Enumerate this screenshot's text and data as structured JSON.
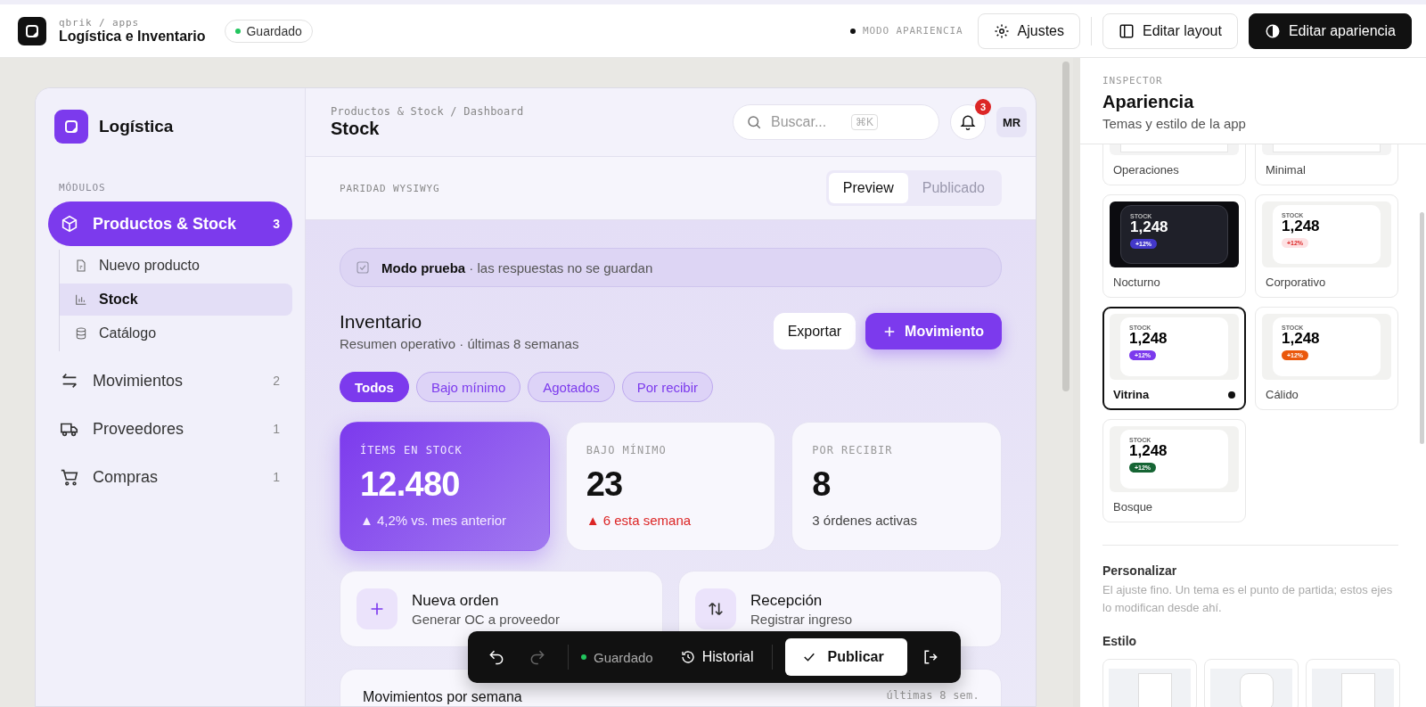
{
  "topbar": {
    "path": "qbrik / apps",
    "title": "Logística e Inventario",
    "status": "Guardado",
    "mode_label": "MODO APARIENCIA",
    "buttons": [
      {
        "label": "Ajustes",
        "kind": "settings",
        "selected": false
      },
      {
        "label": "Editar layout",
        "kind": "layout",
        "selected": false
      },
      {
        "label": "Editar apariencia",
        "kind": "appearance",
        "selected": true
      }
    ]
  },
  "sidebar": {
    "app_name": "Logística",
    "section": "MÓDULOS",
    "items": [
      {
        "label": "Productos & Stock",
        "count": "3",
        "selected": true,
        "expanded": true,
        "children": [
          {
            "label": "Nuevo producto",
            "selected": false
          },
          {
            "label": "Stock",
            "selected": true
          },
          {
            "label": "Catálogo",
            "selected": false
          }
        ]
      },
      {
        "label": "Movimientos",
        "count": "2",
        "selected": false
      },
      {
        "label": "Proveedores",
        "count": "1",
        "selected": false
      },
      {
        "label": "Compras",
        "count": "1",
        "selected": false
      }
    ]
  },
  "header": {
    "breadcrumb": "Productos & Stock / Dashboard",
    "title": "Stock",
    "search": {
      "placeholder": "Buscar...",
      "shortcut": "⌘K"
    },
    "notifications": "3",
    "avatar": "MR"
  },
  "parity": {
    "label": "PARIDAD WYSIWYG",
    "tabs": [
      {
        "label": "Preview",
        "selected": true
      },
      {
        "label": "Publicado",
        "selected": false
      }
    ]
  },
  "banner": "**Modo prueba** · las respuestas no se guardan",
  "section": {
    "title": "Inventario",
    "subtitle": "Resumen operativo · últimas 8 semanas",
    "buttons": [
      {
        "label": "Exportar",
        "kind": "secondary"
      },
      {
        "label": "Movimiento",
        "kind": "primary"
      }
    ]
  },
  "filters": [
    {
      "label": "Todos",
      "selected": true
    },
    {
      "label": "Bajo mínimo",
      "selected": false
    },
    {
      "label": "Agotados",
      "selected": false
    },
    {
      "label": "Por recibir",
      "selected": false
    }
  ],
  "stats": [
    {
      "label": "ÍTEMS EN STOCK",
      "value": "12.480",
      "delta": "▲ 4,2% vs. mes anterior",
      "kind": "highlight",
      "alert": false
    },
    {
      "label": "BAJO MÍNIMO",
      "value": "23",
      "delta": "▲ 6 esta semana",
      "kind": "default",
      "alert": true
    },
    {
      "label": "POR RECIBIR",
      "value": "8",
      "delta": "3 órdenes activas",
      "kind": "default",
      "alert": false
    }
  ],
  "actions": [
    {
      "title": "Nueva orden",
      "subtitle": "Generar OC a proveedor",
      "kind": "add"
    },
    {
      "title": "Recepción",
      "subtitle": "Registrar ingreso",
      "kind": "swap"
    }
  ],
  "chart_card": {
    "title": "Movimientos por semana",
    "range": "últimas 8 sem."
  },
  "toolbar": {
    "undo_disabled": false,
    "redo_disabled": true,
    "status": "Guardado",
    "history": "Historial",
    "publish": "Publicar"
  },
  "inspector": {
    "eyebrow": "INSPECTOR",
    "title": "Apariencia",
    "subtitle": "Temas y estilo de la app",
    "themes": [
      {
        "name": "Operaciones",
        "kind": "clipped",
        "selected": false
      },
      {
        "name": "Minimal",
        "kind": "clipped",
        "selected": false
      },
      {
        "name": "Nocturno",
        "kind": "dark",
        "selected": false,
        "color": "#4338ca",
        "preview": {
          "label": "STOCK",
          "value": "1,248",
          "badge": "+12%"
        }
      },
      {
        "name": "Corporativo",
        "kind": "soft",
        "selected": false,
        "color": "#fde2e4",
        "preview": {
          "label": "STOCK",
          "value": "1,248",
          "badge": "+12%"
        }
      },
      {
        "name": "Vitrina",
        "kind": "light",
        "selected": true,
        "color": "#7c3aed",
        "preview": {
          "label": "STOCK",
          "value": "1,248",
          "badge": "+12%"
        }
      },
      {
        "name": "Cálido",
        "kind": "light",
        "selected": false,
        "color": "#ea580c",
        "preview": {
          "label": "STOCK",
          "value": "1,248",
          "badge": "+12%"
        }
      },
      {
        "name": "Bosque",
        "kind": "light",
        "selected": false,
        "color": "#166534",
        "preview": {
          "label": "STOCK",
          "value": "1,248",
          "badge": "+12%"
        }
      }
    ],
    "customize": {
      "title": "Personalizar",
      "description": "El ajuste fino. Un tema es el punto de partida; estos ejes lo modifican desde ahí."
    },
    "style_label": "Estilo",
    "style_options": [
      {
        "kind": "square",
        "selected": false
      },
      {
        "kind": "round",
        "selected": false
      },
      {
        "kind": "square",
        "selected": false
      }
    ]
  }
}
